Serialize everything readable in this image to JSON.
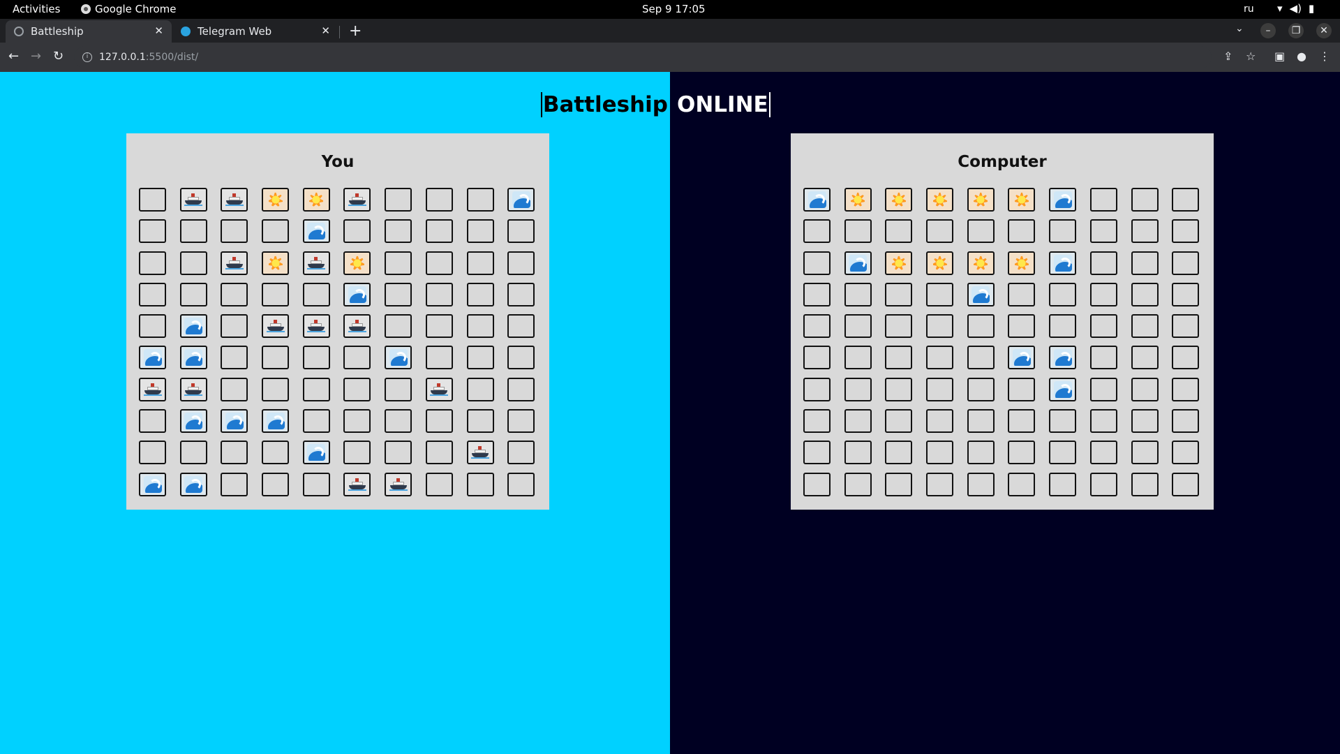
{
  "system_bar": {
    "activities": "Activities",
    "app_name": "Google Chrome",
    "clock": "Sep 9  17:05",
    "language": "ru"
  },
  "browser": {
    "tabs": [
      {
        "title": "Battleship",
        "active": true,
        "icon": "globe-icon"
      },
      {
        "title": "Telegram Web",
        "active": false,
        "icon": "telegram-icon"
      }
    ],
    "url_host": "127.0.0.1",
    "url_path": ":5500/dist/"
  },
  "page": {
    "title_left": "Battleship",
    "title_right": "ONLINE",
    "left_bg": "#00d1ff",
    "right_bg": "#000022"
  },
  "boards": [
    {
      "id": "player",
      "title": "You",
      "rows": [
        [
          "empty",
          "ship",
          "ship",
          "hit",
          "hit",
          "ship",
          "empty",
          "empty",
          "empty",
          "miss"
        ],
        [
          "empty",
          "empty",
          "empty",
          "empty",
          "miss",
          "empty",
          "empty",
          "empty",
          "empty",
          "empty"
        ],
        [
          "empty",
          "empty",
          "ship",
          "hit",
          "ship",
          "hit",
          "empty",
          "empty",
          "empty",
          "empty"
        ],
        [
          "empty",
          "empty",
          "empty",
          "empty",
          "empty",
          "miss",
          "empty",
          "empty",
          "empty",
          "empty"
        ],
        [
          "empty",
          "miss",
          "empty",
          "ship",
          "ship",
          "ship",
          "empty",
          "empty",
          "empty",
          "empty"
        ],
        [
          "miss",
          "miss",
          "empty",
          "empty",
          "empty",
          "empty",
          "miss",
          "empty",
          "empty",
          "empty"
        ],
        [
          "ship",
          "ship",
          "empty",
          "empty",
          "empty",
          "empty",
          "empty",
          "ship",
          "empty",
          "empty"
        ],
        [
          "empty",
          "miss",
          "miss",
          "miss",
          "empty",
          "empty",
          "empty",
          "empty",
          "empty",
          "empty"
        ],
        [
          "empty",
          "empty",
          "empty",
          "empty",
          "miss",
          "empty",
          "empty",
          "empty",
          "ship",
          "empty"
        ],
        [
          "miss",
          "miss",
          "empty",
          "empty",
          "empty",
          "ship",
          "ship",
          "empty",
          "empty",
          "empty"
        ]
      ]
    },
    {
      "id": "computer",
      "title": "Computer",
      "rows": [
        [
          "miss",
          "hit",
          "hit",
          "hit",
          "hit",
          "hit",
          "miss",
          "empty",
          "empty",
          "empty"
        ],
        [
          "empty",
          "empty",
          "empty",
          "empty",
          "empty",
          "empty",
          "empty",
          "empty",
          "empty",
          "empty"
        ],
        [
          "empty",
          "miss",
          "hit",
          "hit",
          "hit",
          "hit",
          "miss",
          "empty",
          "empty",
          "empty"
        ],
        [
          "empty",
          "empty",
          "empty",
          "empty",
          "miss",
          "empty",
          "empty",
          "empty",
          "empty",
          "empty"
        ],
        [
          "empty",
          "empty",
          "empty",
          "empty",
          "empty",
          "empty",
          "empty",
          "empty",
          "empty",
          "empty"
        ],
        [
          "empty",
          "empty",
          "empty",
          "empty",
          "empty",
          "miss",
          "miss",
          "empty",
          "empty",
          "empty"
        ],
        [
          "empty",
          "empty",
          "empty",
          "empty",
          "empty",
          "empty",
          "miss",
          "empty",
          "empty",
          "empty"
        ],
        [
          "empty",
          "empty",
          "empty",
          "empty",
          "empty",
          "empty",
          "empty",
          "empty",
          "empty",
          "empty"
        ],
        [
          "empty",
          "empty",
          "empty",
          "empty",
          "empty",
          "empty",
          "empty",
          "empty",
          "empty",
          "empty"
        ],
        [
          "empty",
          "empty",
          "empty",
          "empty",
          "empty",
          "empty",
          "empty",
          "empty",
          "empty",
          "empty"
        ]
      ]
    }
  ]
}
